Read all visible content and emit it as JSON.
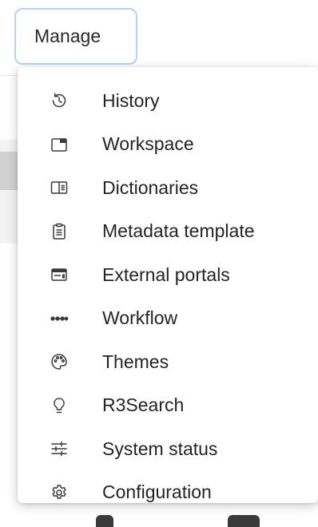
{
  "manage_button": {
    "label": "Manage"
  },
  "menu": {
    "items": [
      {
        "label": "History",
        "icon": "history-icon"
      },
      {
        "label": "Workspace",
        "icon": "window-icon"
      },
      {
        "label": "Dictionaries",
        "icon": "book-panel-icon"
      },
      {
        "label": "Metadata template",
        "icon": "clipboard-icon"
      },
      {
        "label": "External portals",
        "icon": "portal-icon"
      },
      {
        "label": "Workflow",
        "icon": "dots-flow-icon"
      },
      {
        "label": "Themes",
        "icon": "palette-icon"
      },
      {
        "label": "R3Search",
        "icon": "lightbulb-icon"
      },
      {
        "label": "System status",
        "icon": "sliders-icon"
      },
      {
        "label": "Configuration",
        "icon": "gear-icon"
      }
    ]
  },
  "colors": {
    "focus_border": "#b8d4f4",
    "text": "#242424",
    "icon": "#3a3a3a"
  }
}
